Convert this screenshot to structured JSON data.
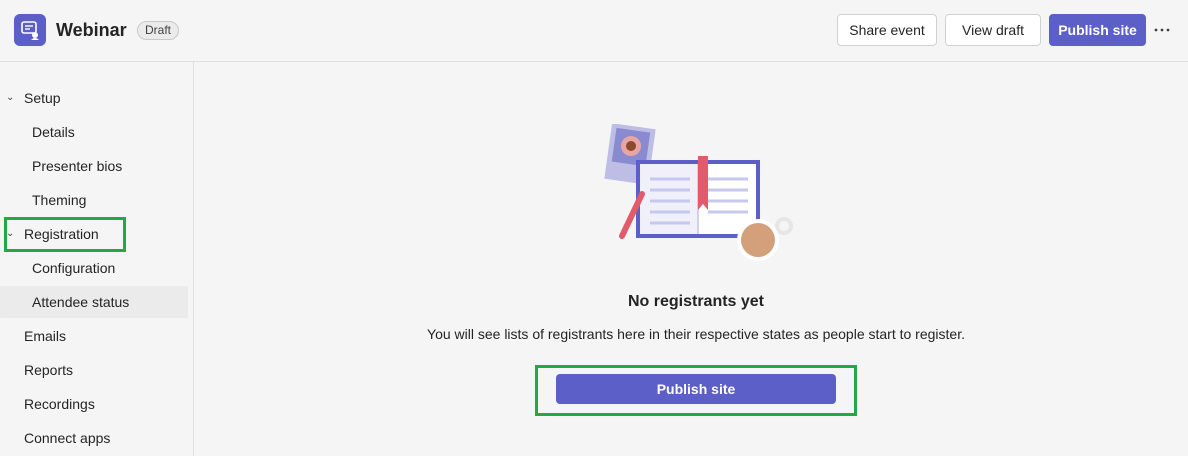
{
  "header": {
    "title": "Webinar",
    "badge": "Draft",
    "buttons": {
      "share": "Share event",
      "view_draft": "View draft",
      "publish": "Publish site"
    },
    "more_icon": "more-horizontal-icon"
  },
  "sidebar": {
    "items": [
      {
        "label": "Setup",
        "expanded": true
      },
      {
        "label": "Details"
      },
      {
        "label": "Presenter bios"
      },
      {
        "label": "Theming"
      },
      {
        "label": "Registration",
        "expanded": true
      },
      {
        "label": "Configuration"
      },
      {
        "label": "Attendee status",
        "selected": true
      },
      {
        "label": "Emails"
      },
      {
        "label": "Reports"
      },
      {
        "label": "Recordings"
      },
      {
        "label": "Connect apps"
      }
    ]
  },
  "main": {
    "empty_title": "No registrants yet",
    "empty_description": "You will see lists of registrants here in their respective states as people start to register.",
    "publish_button": "Publish site"
  },
  "colors": {
    "accent": "#5b5fc7",
    "highlight": "#22a845",
    "background": "#f5f5f5"
  }
}
